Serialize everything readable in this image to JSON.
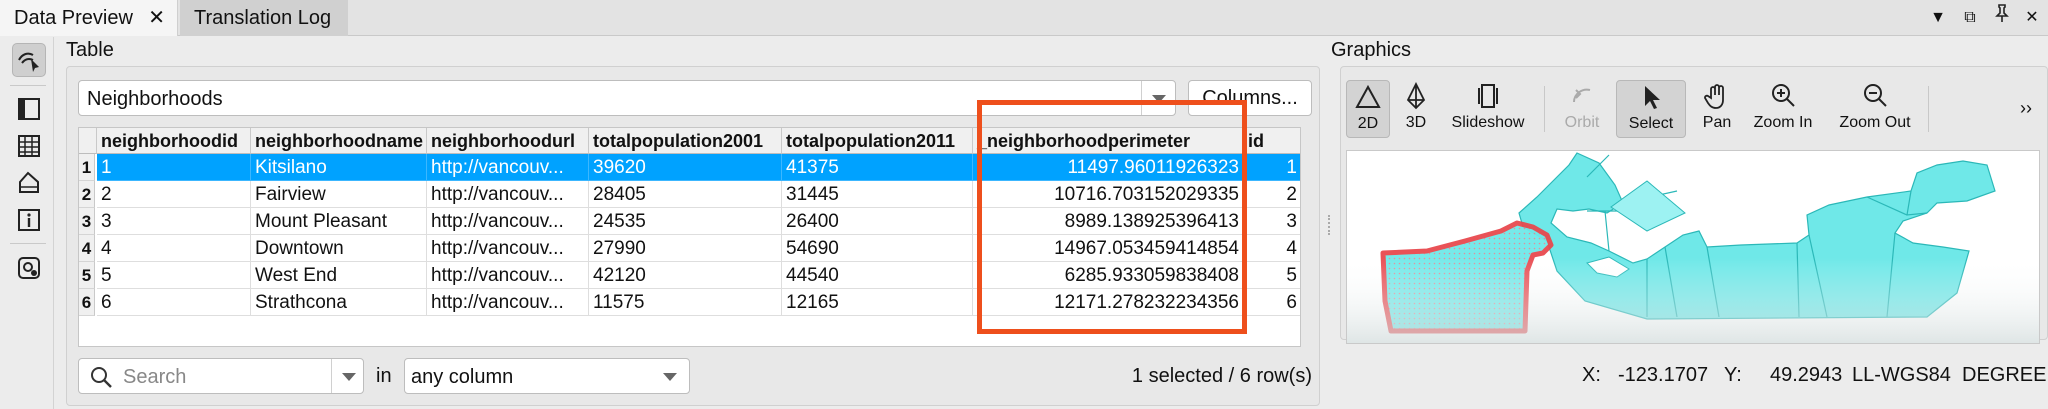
{
  "tabs": [
    {
      "label": "Data Preview",
      "close": "✕"
    },
    {
      "label": "Translation Log"
    }
  ],
  "window_controls": [
    "▼",
    "⧉",
    "📌",
    "✕"
  ],
  "left_toolbar": [
    "inspect-icon",
    "feature-info-icon",
    "table-view-icon",
    "geometry-icon",
    "information-icon",
    "settings-icon"
  ],
  "table_panel": {
    "title": "Table",
    "dataset": "Neighborhoods",
    "columns_button": "Columns...",
    "columns": [
      "neighborhoodid",
      "neighborhoodname",
      "neighborhoodurl",
      "totalpopulation2001",
      "totalpopulation2011",
      "_neighborhoodperimeter",
      "id"
    ],
    "rows": [
      {
        "num": "1",
        "cells": [
          "1",
          "Kitsilano",
          "http://vancouv...",
          "39620",
          "41375",
          "11497.96011926323",
          "1"
        ]
      },
      {
        "num": "2",
        "cells": [
          "2",
          "Fairview",
          "http://vancouv...",
          "28405",
          "31445",
          "10716.703152029335",
          "2"
        ]
      },
      {
        "num": "3",
        "cells": [
          "3",
          "Mount Pleasant",
          "http://vancouv...",
          "24535",
          "26400",
          "8989.138925396413",
          "3"
        ]
      },
      {
        "num": "4",
        "cells": [
          "4",
          "Downtown",
          "http://vancouv...",
          "27990",
          "54690",
          "14967.053459414854",
          "4"
        ]
      },
      {
        "num": "5",
        "cells": [
          "5",
          "West End",
          "http://vancouv...",
          "42120",
          "44540",
          "6285.933059838408",
          "5"
        ]
      },
      {
        "num": "6",
        "cells": [
          "6",
          "Strathcona",
          "http://vancouv...",
          "11575",
          "12165",
          "12171.278232234356",
          "6"
        ]
      }
    ],
    "selected_row": 1,
    "search_placeholder": "Search",
    "in_label": "in",
    "column_filter": "any column",
    "status": "1 selected / 6 row(s)"
  },
  "graphics_panel": {
    "title": "Graphics",
    "tools": [
      {
        "label": "2D",
        "icon": "2d-icon"
      },
      {
        "label": "3D",
        "icon": "3d-icon"
      },
      {
        "label": "Slideshow",
        "icon": "slideshow-icon"
      },
      {
        "label": "Orbit",
        "icon": "orbit-icon"
      },
      {
        "label": "Select",
        "icon": "select-icon"
      },
      {
        "label": "Pan",
        "icon": "pan-icon"
      },
      {
        "label": "Zoom In",
        "icon": "zoom-in-icon"
      },
      {
        "label": "Zoom Out",
        "icon": "zoom-out-icon"
      }
    ],
    "more": "››",
    "coords": {
      "x_label": "X:",
      "x": "-123.1707",
      "y_label": "Y:",
      "y": "49.2943",
      "crs": "LL-WGS84",
      "units": "DEGREE"
    }
  },
  "colors": {
    "selection": "#00a2ff",
    "highlight_box": "#ee4f1c",
    "map_fill": "#6fe8e8",
    "selected_feature": "#e8494f"
  }
}
